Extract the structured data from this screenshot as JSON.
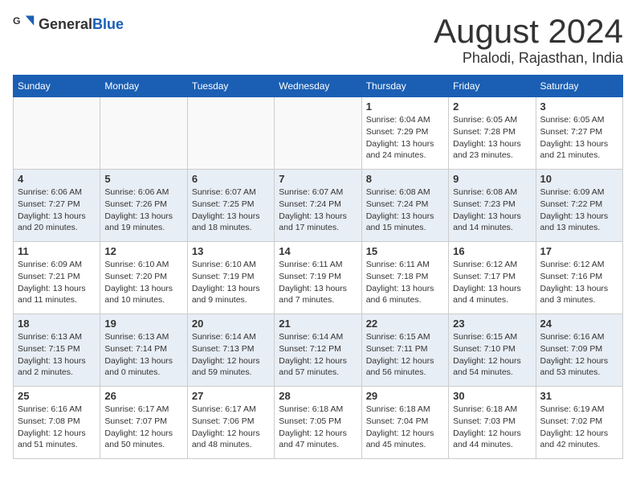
{
  "logo": {
    "text_general": "General",
    "text_blue": "Blue"
  },
  "title": {
    "month_year": "August 2024",
    "location": "Phalodi, Rajasthan, India"
  },
  "weekdays": [
    "Sunday",
    "Monday",
    "Tuesday",
    "Wednesday",
    "Thursday",
    "Friday",
    "Saturday"
  ],
  "weeks": [
    [
      {
        "day": "",
        "info": ""
      },
      {
        "day": "",
        "info": ""
      },
      {
        "day": "",
        "info": ""
      },
      {
        "day": "",
        "info": ""
      },
      {
        "day": "1",
        "info": "Sunrise: 6:04 AM\nSunset: 7:29 PM\nDaylight: 13 hours\nand 24 minutes."
      },
      {
        "day": "2",
        "info": "Sunrise: 6:05 AM\nSunset: 7:28 PM\nDaylight: 13 hours\nand 23 minutes."
      },
      {
        "day": "3",
        "info": "Sunrise: 6:05 AM\nSunset: 7:27 PM\nDaylight: 13 hours\nand 21 minutes."
      }
    ],
    [
      {
        "day": "4",
        "info": "Sunrise: 6:06 AM\nSunset: 7:27 PM\nDaylight: 13 hours\nand 20 minutes."
      },
      {
        "day": "5",
        "info": "Sunrise: 6:06 AM\nSunset: 7:26 PM\nDaylight: 13 hours\nand 19 minutes."
      },
      {
        "day": "6",
        "info": "Sunrise: 6:07 AM\nSunset: 7:25 PM\nDaylight: 13 hours\nand 18 minutes."
      },
      {
        "day": "7",
        "info": "Sunrise: 6:07 AM\nSunset: 7:24 PM\nDaylight: 13 hours\nand 17 minutes."
      },
      {
        "day": "8",
        "info": "Sunrise: 6:08 AM\nSunset: 7:24 PM\nDaylight: 13 hours\nand 15 minutes."
      },
      {
        "day": "9",
        "info": "Sunrise: 6:08 AM\nSunset: 7:23 PM\nDaylight: 13 hours\nand 14 minutes."
      },
      {
        "day": "10",
        "info": "Sunrise: 6:09 AM\nSunset: 7:22 PM\nDaylight: 13 hours\nand 13 minutes."
      }
    ],
    [
      {
        "day": "11",
        "info": "Sunrise: 6:09 AM\nSunset: 7:21 PM\nDaylight: 13 hours\nand 11 minutes."
      },
      {
        "day": "12",
        "info": "Sunrise: 6:10 AM\nSunset: 7:20 PM\nDaylight: 13 hours\nand 10 minutes."
      },
      {
        "day": "13",
        "info": "Sunrise: 6:10 AM\nSunset: 7:19 PM\nDaylight: 13 hours\nand 9 minutes."
      },
      {
        "day": "14",
        "info": "Sunrise: 6:11 AM\nSunset: 7:19 PM\nDaylight: 13 hours\nand 7 minutes."
      },
      {
        "day": "15",
        "info": "Sunrise: 6:11 AM\nSunset: 7:18 PM\nDaylight: 13 hours\nand 6 minutes."
      },
      {
        "day": "16",
        "info": "Sunrise: 6:12 AM\nSunset: 7:17 PM\nDaylight: 13 hours\nand 4 minutes."
      },
      {
        "day": "17",
        "info": "Sunrise: 6:12 AM\nSunset: 7:16 PM\nDaylight: 13 hours\nand 3 minutes."
      }
    ],
    [
      {
        "day": "18",
        "info": "Sunrise: 6:13 AM\nSunset: 7:15 PM\nDaylight: 13 hours\nand 2 minutes."
      },
      {
        "day": "19",
        "info": "Sunrise: 6:13 AM\nSunset: 7:14 PM\nDaylight: 13 hours\nand 0 minutes."
      },
      {
        "day": "20",
        "info": "Sunrise: 6:14 AM\nSunset: 7:13 PM\nDaylight: 12 hours\nand 59 minutes."
      },
      {
        "day": "21",
        "info": "Sunrise: 6:14 AM\nSunset: 7:12 PM\nDaylight: 12 hours\nand 57 minutes."
      },
      {
        "day": "22",
        "info": "Sunrise: 6:15 AM\nSunset: 7:11 PM\nDaylight: 12 hours\nand 56 minutes."
      },
      {
        "day": "23",
        "info": "Sunrise: 6:15 AM\nSunset: 7:10 PM\nDaylight: 12 hours\nand 54 minutes."
      },
      {
        "day": "24",
        "info": "Sunrise: 6:16 AM\nSunset: 7:09 PM\nDaylight: 12 hours\nand 53 minutes."
      }
    ],
    [
      {
        "day": "25",
        "info": "Sunrise: 6:16 AM\nSunset: 7:08 PM\nDaylight: 12 hours\nand 51 minutes."
      },
      {
        "day": "26",
        "info": "Sunrise: 6:17 AM\nSunset: 7:07 PM\nDaylight: 12 hours\nand 50 minutes."
      },
      {
        "day": "27",
        "info": "Sunrise: 6:17 AM\nSunset: 7:06 PM\nDaylight: 12 hours\nand 48 minutes."
      },
      {
        "day": "28",
        "info": "Sunrise: 6:18 AM\nSunset: 7:05 PM\nDaylight: 12 hours\nand 47 minutes."
      },
      {
        "day": "29",
        "info": "Sunrise: 6:18 AM\nSunset: 7:04 PM\nDaylight: 12 hours\nand 45 minutes."
      },
      {
        "day": "30",
        "info": "Sunrise: 6:18 AM\nSunset: 7:03 PM\nDaylight: 12 hours\nand 44 minutes."
      },
      {
        "day": "31",
        "info": "Sunrise: 6:19 AM\nSunset: 7:02 PM\nDaylight: 12 hours\nand 42 minutes."
      }
    ]
  ]
}
